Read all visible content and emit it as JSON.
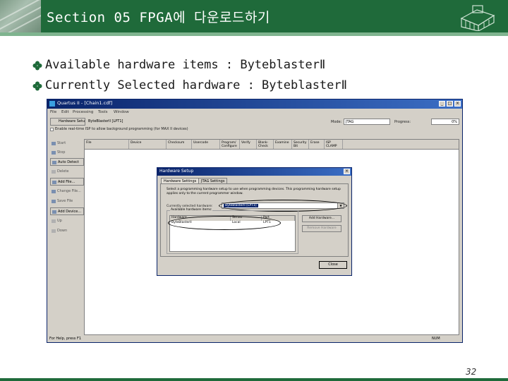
{
  "slide": {
    "title": "Section 05 FPGA에 다운로드하기",
    "bullets": [
      "Available hardware items : ByteblasterⅡ",
      "Currently Selected hardware : ByteblasterⅡ"
    ],
    "page_number": "32",
    "colors": {
      "header": "#1f6a3a",
      "accent": "#7fb48f",
      "bullet": "#1f6a3a"
    }
  },
  "app": {
    "window_title": "Quartus II - [Chain1.cdf]",
    "menu": [
      "File",
      "Edit",
      "Processing",
      "Tools",
      "Window"
    ],
    "toolbar": {
      "hardware_setup_button": "Hardware Setup...",
      "hardware_value": "ByteBlasterII [LPT1]",
      "mode_label": "Mode:",
      "mode_value": "JTAG",
      "progress_label": "Progress:",
      "progress_value": "0%",
      "checkbox_label": "Enable real-time ISP to allow background programming (for MAX II devices)"
    },
    "side_buttons": [
      "Start",
      "Stop",
      "Auto Detect",
      "Delete",
      "Add File...",
      "Change File...",
      "Save File",
      "Add Device...",
      "Up",
      "Down"
    ],
    "table_headers": [
      "File",
      "Device",
      "Checksum",
      "Usercode",
      "Program/ Configure",
      "Verify",
      "Blank- Check",
      "Examine",
      "Security Bit",
      "Erase",
      "ISP CLAMP"
    ],
    "status_text": "For Help, press F1",
    "status_right": "NUM"
  },
  "dialog": {
    "title": "Hardware Setup",
    "tabs": [
      "Hardware Settings",
      "JTAG Settings"
    ],
    "description": "Select a programming hardware setup to use when programming devices. This programming hardware setup applies only to the current programmer window.",
    "current_label": "Currently selected hardware:",
    "current_value": "ByteBlasterII [LPT1]",
    "available_label": "Available hardware items:",
    "columns": [
      "Hardware",
      "Server",
      "Port"
    ],
    "rows": [
      [
        "ByteBlasterII",
        "Local",
        "LPT1"
      ]
    ],
    "add_button": "Add Hardware...",
    "remove_button": "Remove Hardware",
    "close_button": "Close"
  }
}
